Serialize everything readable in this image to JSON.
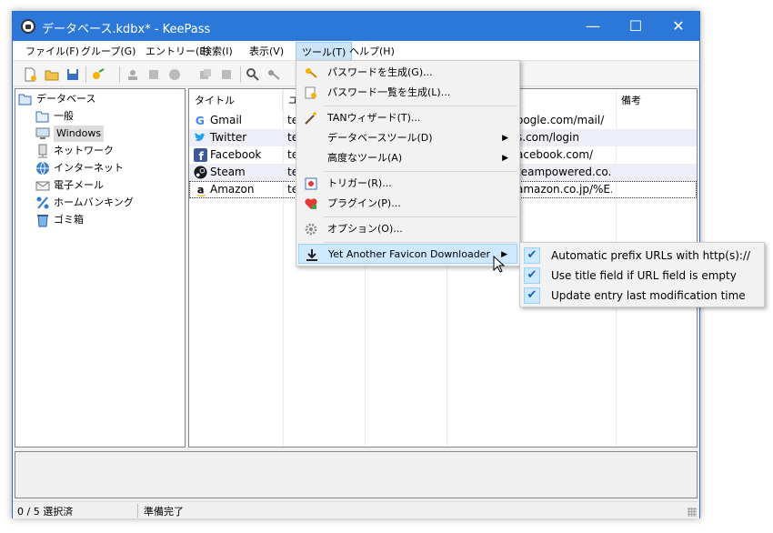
{
  "window": {
    "title": "データベース.kdbx* - KeePass",
    "minimize_glyph": "—",
    "maximize_glyph": "☐",
    "close_glyph": "✕"
  },
  "menubar": {
    "items": [
      "ファイル(F)",
      "グループ(G)",
      "エントリー(E)",
      "検索(I)",
      "表示(V)",
      "ツール(T)",
      "ヘルプ(H)"
    ]
  },
  "tree": {
    "root": "データベース",
    "items": [
      "一般",
      "Windows",
      "ネットワーク",
      "インターネット",
      "電子メール",
      "ホームバンキング",
      "ゴミ箱"
    ],
    "selected": "Windows"
  },
  "list": {
    "columns": [
      "タイトル",
      "ユ",
      "備考"
    ],
    "rows": [
      {
        "title": "Gmail",
        "user": "te",
        "url": "oogle.com/mail/",
        "icon": "G",
        "icon_color": "#ffffff"
      },
      {
        "title": "Twitter",
        "user": "te",
        "url": "s.com/login",
        "icon": "t",
        "icon_color": "#1da1f2"
      },
      {
        "title": "Facebook",
        "user": "te",
        "url": "acebook.com/",
        "icon": "f",
        "icon_color": "#3b5998"
      },
      {
        "title": "Steam",
        "user": "te",
        "url": "teampowered.co...",
        "icon": "S",
        "icon_color": "#171a21"
      },
      {
        "title": "Amazon",
        "user": "te",
        "url": "amazon.co.jp/%E...",
        "icon": "a",
        "icon_color": "#ffffff"
      }
    ]
  },
  "tools_menu": {
    "items": [
      {
        "label": "パスワードを生成(G)...",
        "icon": "key-generate-icon"
      },
      {
        "label": "パスワード一覧を生成(L)...",
        "icon": "key-list-icon"
      },
      {
        "label": "TANウィザード(T)...",
        "icon": "wand-icon"
      },
      {
        "label": "データベースツール(D)",
        "icon": "",
        "submenu": true
      },
      {
        "label": "高度なツール(A)",
        "icon": "",
        "submenu": true
      },
      {
        "label": "トリガー(R)...",
        "icon": "trigger-icon"
      },
      {
        "label": "プラグイン(P)...",
        "icon": "plugin-icon"
      },
      {
        "label": "オプション(O)...",
        "icon": "gear-icon"
      },
      {
        "label": "Yet Another Favicon Downloader",
        "icon": "download-icon",
        "submenu": true,
        "highlighted": true
      }
    ],
    "arrow_glyph": "▶"
  },
  "favicon_submenu": {
    "items": [
      {
        "label": "Automatic prefix URLs with http(s)://",
        "checked": true
      },
      {
        "label": "Use title field if URL field is empty",
        "checked": true
      },
      {
        "label": "Update entry last modification time",
        "checked": true
      }
    ],
    "check_glyph": "✔"
  },
  "status": {
    "selection": "0 / 5 選択済",
    "state": "準備完了"
  },
  "colors": {
    "titlebar": "#2b78d9",
    "highlight": "#cde8ff",
    "row_alt": "#eeeef8"
  }
}
